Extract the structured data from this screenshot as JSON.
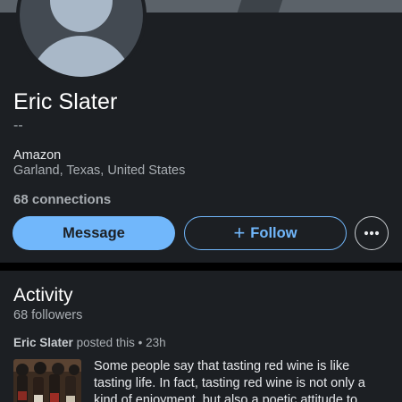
{
  "profile": {
    "name": "Eric Slater",
    "headline": "--",
    "company": "Amazon",
    "location": "Garland, Texas, United States",
    "connections": "68 connections"
  },
  "actions": {
    "message_label": "Message",
    "follow_label": "Follow",
    "follow_icon": "plus-icon",
    "more_icon": "more-icon"
  },
  "activity": {
    "title": "Activity",
    "followers": "68 followers",
    "post": {
      "author": "Eric Slater",
      "action": "posted this",
      "separator": "•",
      "time": "23h",
      "text": "Some people say that tasting red wine is like tasting life. In fact, tasting red wine is not only a kind of enjoyment, but also a poetic attitude to...",
      "thumbnail_icon": "wine-bottles-image"
    }
  },
  "colors": {
    "background": "#000000",
    "card": "#1c1f23",
    "accent": "#71b7fb",
    "text_primary": "#ffffff",
    "text_secondary": "#a9aeb3"
  }
}
